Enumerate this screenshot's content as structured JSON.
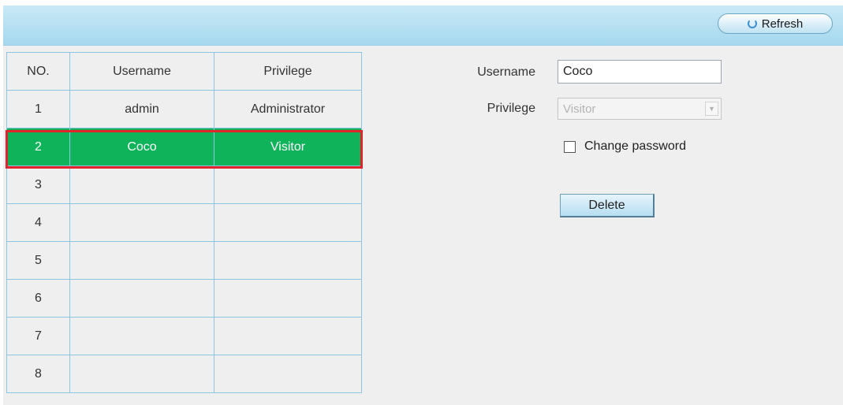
{
  "toolbar": {
    "refresh_label": "Refresh"
  },
  "table": {
    "headers": [
      "NO.",
      "Username",
      "Privilege"
    ],
    "rows": [
      {
        "no": "1",
        "username": "admin",
        "privilege": "Administrator"
      },
      {
        "no": "2",
        "username": "Coco",
        "privilege": "Visitor"
      },
      {
        "no": "3",
        "username": "",
        "privilege": ""
      },
      {
        "no": "4",
        "username": "",
        "privilege": ""
      },
      {
        "no": "5",
        "username": "",
        "privilege": ""
      },
      {
        "no": "6",
        "username": "",
        "privilege": ""
      },
      {
        "no": "7",
        "username": "",
        "privilege": ""
      },
      {
        "no": "8",
        "username": "",
        "privilege": ""
      }
    ],
    "selected_row": 2
  },
  "form": {
    "username_label": "Username",
    "username_value": "Coco",
    "privilege_label": "Privilege",
    "privilege_value": "Visitor",
    "privilege_disabled": true,
    "change_password_label": "Change password",
    "change_password_checked": false,
    "delete_label": "Delete"
  },
  "colors": {
    "selected_row": "#0fb35a",
    "selected_outline": "#e0242b",
    "header_bar": "#b5dff1",
    "table_border": "#8cc6e4"
  }
}
